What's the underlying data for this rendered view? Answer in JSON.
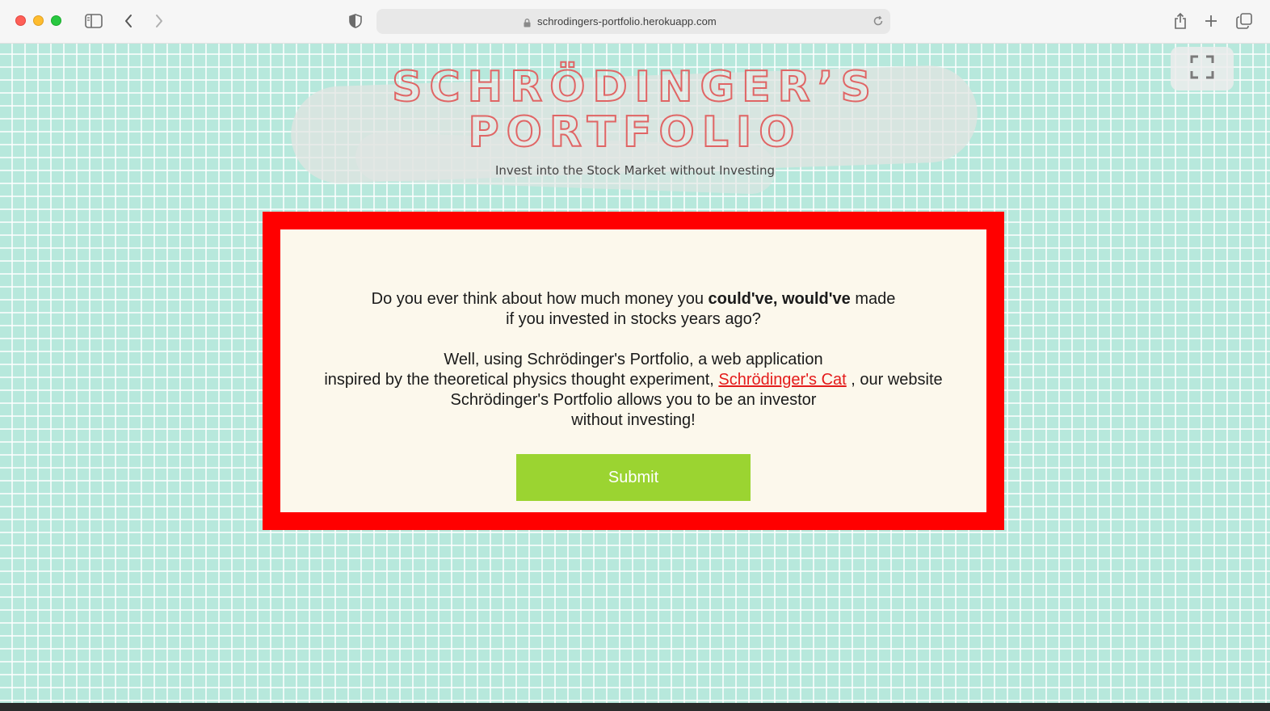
{
  "browser": {
    "url": "schrodingers-portfolio.herokuapp.com",
    "icons": {
      "sidebar": "sidebar-icon",
      "back": "chevron-left-icon",
      "forward": "chevron-right-icon",
      "privacy": "shield-icon",
      "lock": "lock-icon",
      "reload": "reload-icon",
      "share": "share-icon",
      "new_tab": "plus-icon",
      "tabs": "tabs-overview-icon",
      "fullscreen": "fullscreen-icon"
    }
  },
  "header": {
    "logo_line1": "SCHRÖDINGER’S",
    "logo_line2": "PORTFOLIO",
    "tagline": "Invest into the Stock Market without Investing"
  },
  "card": {
    "q_part1": "Do you ever think about how much money you ",
    "q_bold": "could've, would've",
    "q_part2": " made",
    "q_line2": "if you invested in stocks years ago?",
    "p2_line1": "Well, using Schrödinger's Portfolio, a web application",
    "p2_line2_pre": "inspired by the theoretical physics thought experiment, ",
    "p2_link": "Schrödinger's Cat",
    "p2_line2_post": " , our website",
    "p2_line3": "Schrödinger's Portfolio allows you to be an investor",
    "p2_line4": "without investing!",
    "submit_label": "Submit"
  },
  "colors": {
    "background_grid": "#b7e8dc",
    "frame": "#ff0000",
    "card_fill": "#fcf8ec",
    "logo": "#e06565",
    "link": "#e41b1b",
    "button": "#9bd431"
  }
}
